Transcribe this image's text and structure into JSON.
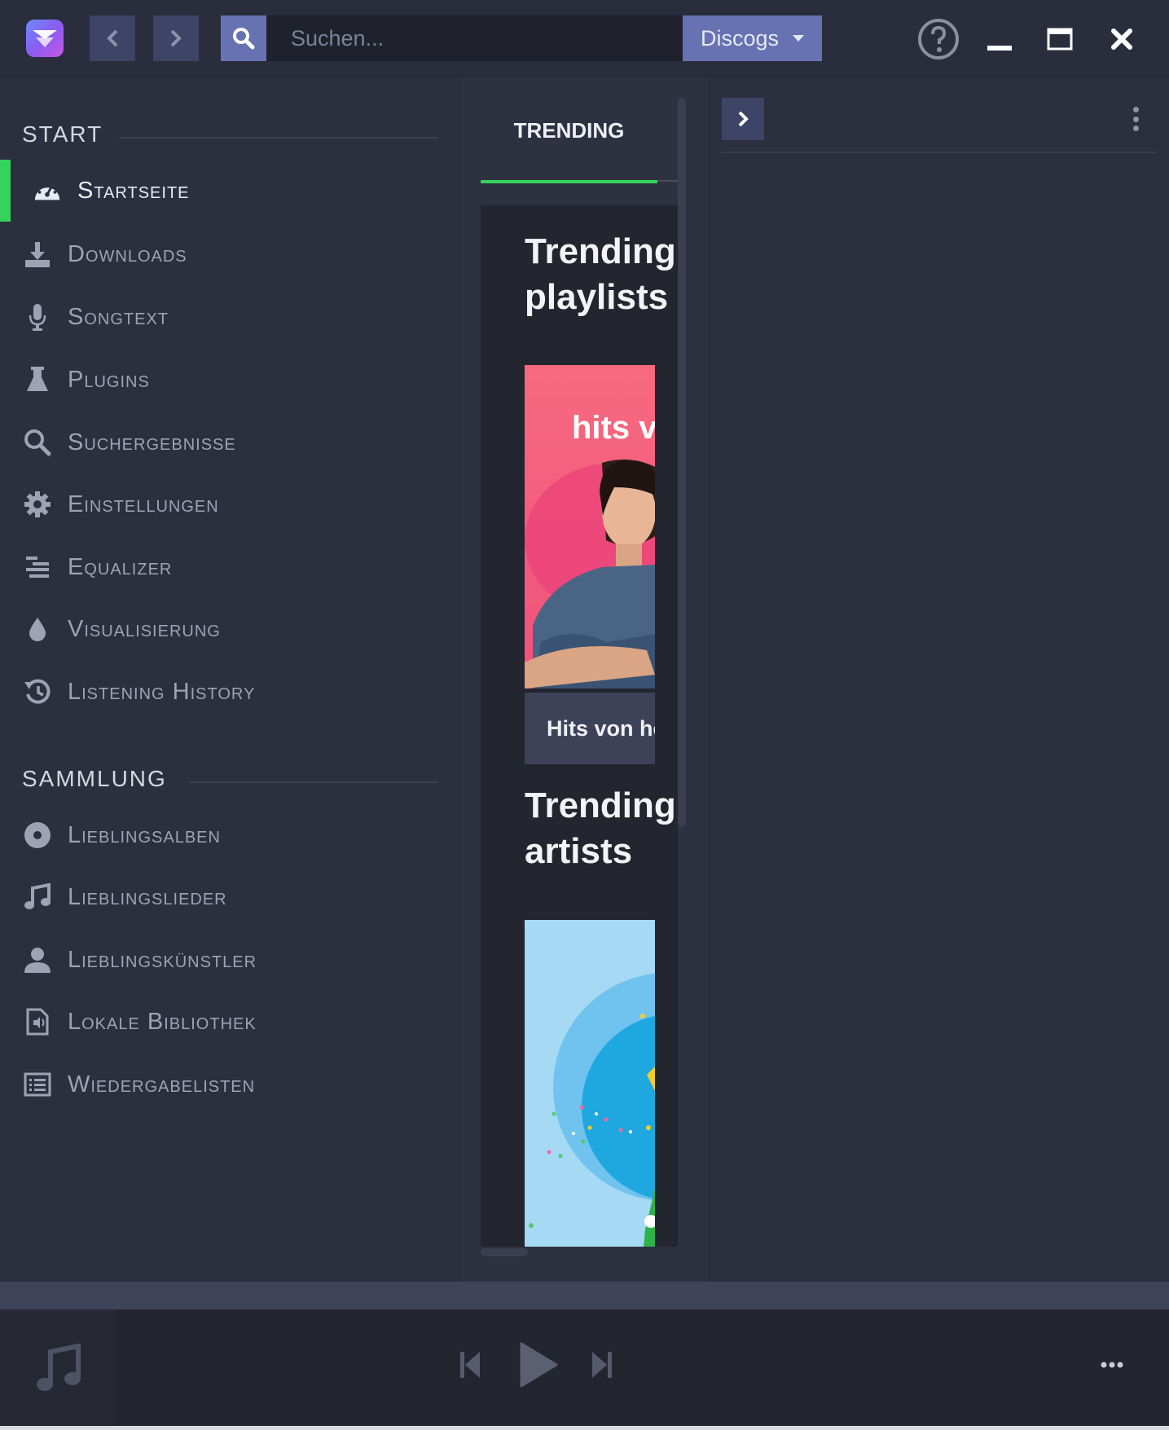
{
  "search": {
    "placeholder": "Suchen..."
  },
  "provider": {
    "selected": "Discogs"
  },
  "sidebar": {
    "start_heading": "START",
    "collection_heading": "SAMMLUNG",
    "items": [
      {
        "label": "Startseite",
        "icon": "dashboard-icon"
      },
      {
        "label": "Downloads",
        "icon": "download-icon"
      },
      {
        "label": "Songtext",
        "icon": "microphone-icon"
      },
      {
        "label": "Plugins",
        "icon": "flask-icon"
      },
      {
        "label": "Suchergebnisse",
        "icon": "search-icon"
      },
      {
        "label": "Einstellungen",
        "icon": "gear-icon"
      },
      {
        "label": "Equalizer",
        "icon": "equalizer-icon"
      },
      {
        "label": "Visualisierung",
        "icon": "drop-icon"
      },
      {
        "label": "Listening History",
        "icon": "history-icon"
      }
    ],
    "collection": [
      {
        "label": "Lieblingsalben",
        "icon": "disc-icon"
      },
      {
        "label": "Lieblingslieder",
        "icon": "music-note-icon"
      },
      {
        "label": "Lieblingskünstler",
        "icon": "user-icon"
      },
      {
        "label": "Lokale Bibliothek",
        "icon": "file-audio-icon"
      },
      {
        "label": "Wiedergabelisten",
        "icon": "list-icon"
      }
    ]
  },
  "dashboard": {
    "tab": "TRENDING",
    "playlists_title": "Trending playlists",
    "playlist_tile": {
      "image_text": "hits v",
      "caption": "Hits von he"
    },
    "artists_title": "Trending artists"
  },
  "colors": {
    "accent": "#35d35e",
    "button": "#6772b3",
    "background": "#2c2f3d"
  }
}
